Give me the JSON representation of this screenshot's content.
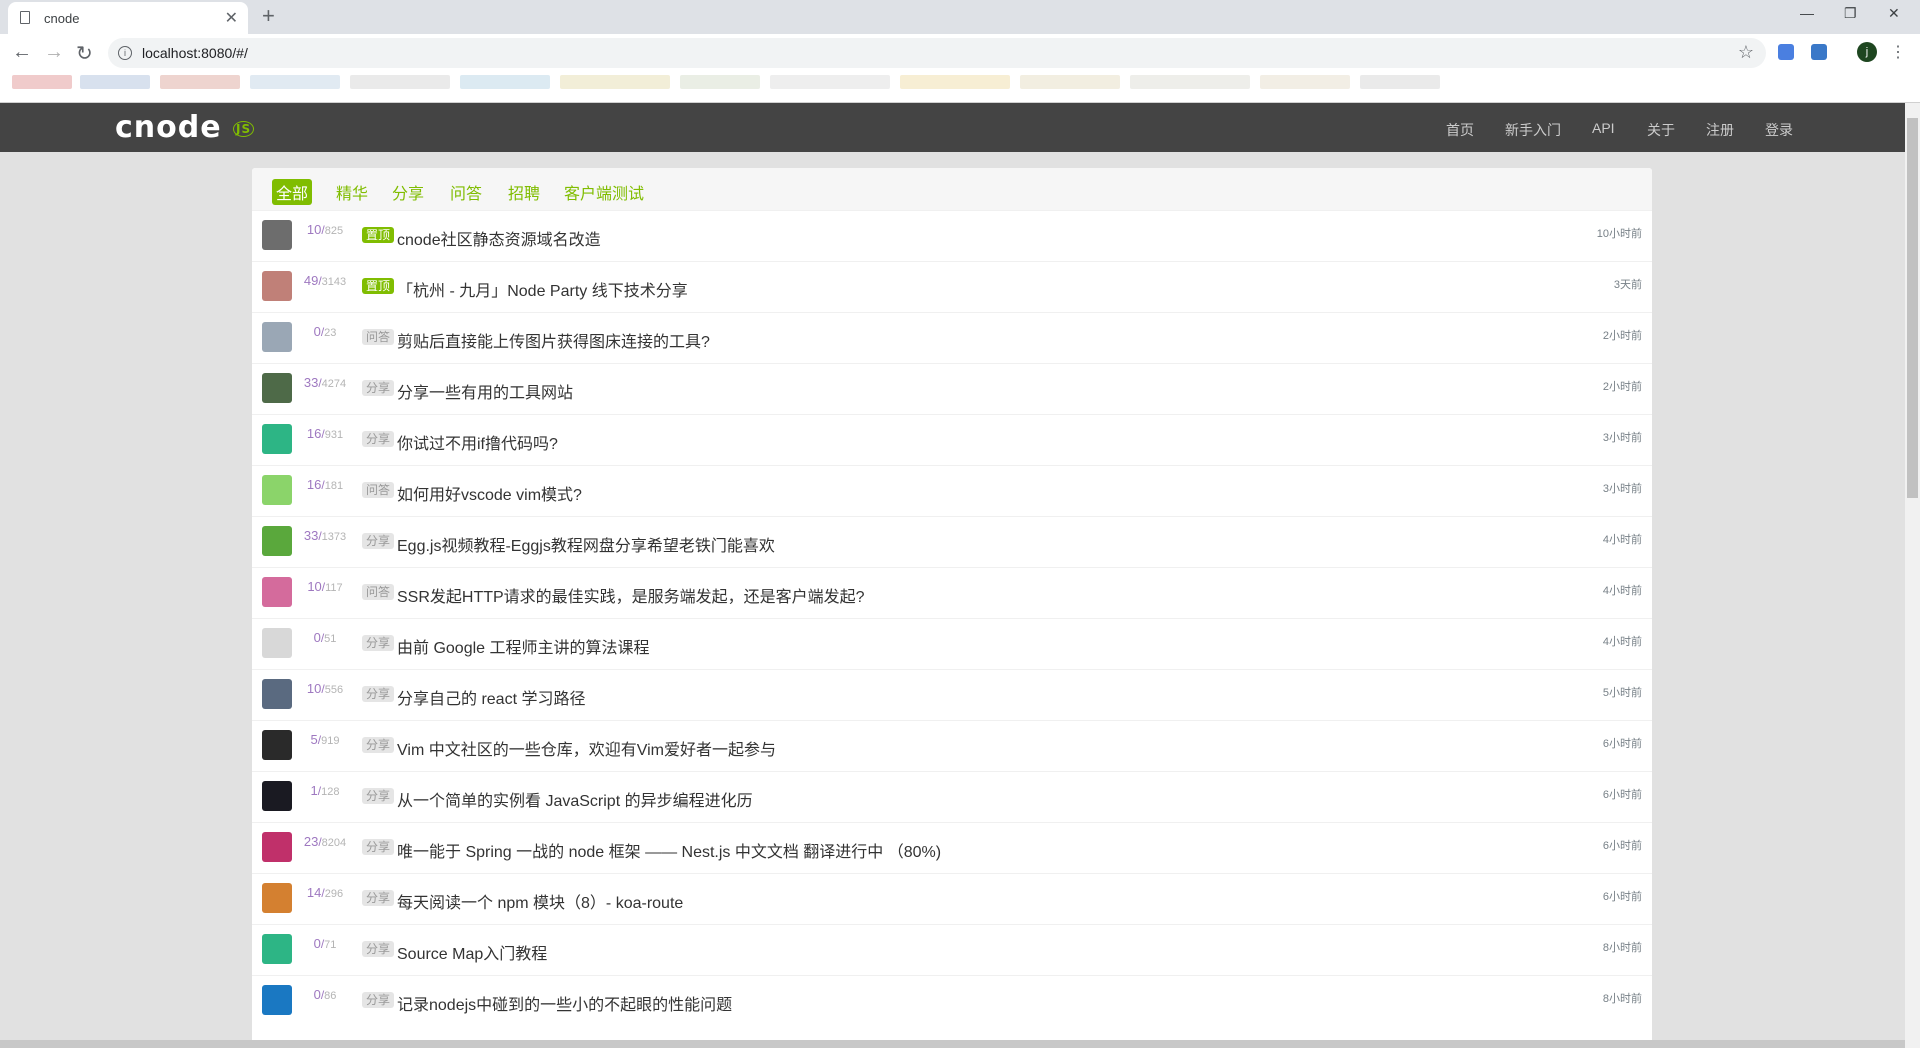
{
  "browser": {
    "tab_title": "cnode",
    "url": "localhost:8080/#/",
    "profile_initial": "j"
  },
  "site": {
    "logo": "cnode",
    "nav": [
      "首页",
      "新手入门",
      "API",
      "关于",
      "注册",
      "登录"
    ]
  },
  "tabs": [
    "全部",
    "精华",
    "分享",
    "问答",
    "招聘",
    "客户端测试"
  ],
  "topics": [
    {
      "reply": "10",
      "visit": "825",
      "tag": "置顶",
      "tag_type": "top",
      "title": "cnode社区静态资源域名改造",
      "time": "10小时前",
      "avatar": "#6d6d6d"
    },
    {
      "reply": "49",
      "visit": "3143",
      "tag": "置顶",
      "tag_type": "top",
      "title": "「杭州 - 九月」Node Party 线下技术分享",
      "time": "3天前",
      "avatar": "#c08078"
    },
    {
      "reply": "0",
      "visit": "23",
      "tag": "问答",
      "tag_type": "normal",
      "title": "剪贴后直接能上传图片获得图床连接的工具?",
      "time": "2小时前",
      "avatar": "#9aa7b5"
    },
    {
      "reply": "33",
      "visit": "4274",
      "tag": "分享",
      "tag_type": "normal",
      "title": "分享一些有用的工具网站",
      "time": "2小时前",
      "avatar": "#4e6a48"
    },
    {
      "reply": "16",
      "visit": "931",
      "tag": "分享",
      "tag_type": "normal",
      "title": "你试过不用if撸代码吗?",
      "time": "3小时前",
      "avatar": "#2db585"
    },
    {
      "reply": "16",
      "visit": "181",
      "tag": "问答",
      "tag_type": "normal",
      "title": "如何用好vscode vim模式?",
      "time": "3小时前",
      "avatar": "#8bd46a"
    },
    {
      "reply": "33",
      "visit": "1373",
      "tag": "分享",
      "tag_type": "normal",
      "title": "Egg.js视频教程-Eggjs教程网盘分享希望老铁门能喜欢",
      "time": "4小时前",
      "avatar": "#5aa83c"
    },
    {
      "reply": "10",
      "visit": "117",
      "tag": "问答",
      "tag_type": "normal",
      "title": "SSR发起HTTP请求的最佳实践，是服务端发起，还是客户端发起?",
      "time": "4小时前",
      "avatar": "#d46b9c"
    },
    {
      "reply": "0",
      "visit": "51",
      "tag": "分享",
      "tag_type": "normal",
      "title": "由前 Google 工程师主讲的算法课程",
      "time": "4小时前",
      "avatar": "#d8d8d8"
    },
    {
      "reply": "10",
      "visit": "556",
      "tag": "分享",
      "tag_type": "normal",
      "title": "分享自己的 react 学习路径",
      "time": "5小时前",
      "avatar": "#5a6a80"
    },
    {
      "reply": "5",
      "visit": "919",
      "tag": "分享",
      "tag_type": "normal",
      "title": "Vim 中文社区的一些仓库，欢迎有Vim爱好者一起参与",
      "time": "6小时前",
      "avatar": "#2a2a2a"
    },
    {
      "reply": "1",
      "visit": "128",
      "tag": "分享",
      "tag_type": "normal",
      "title": "从一个简单的实例看 JavaScript 的异步编程进化历",
      "time": "6小时前",
      "avatar": "#1a1a22"
    },
    {
      "reply": "23",
      "visit": "8204",
      "tag": "分享",
      "tag_type": "normal",
      "title": "唯一能于 Spring 一战的 node 框架 —— Nest.js 中文文档 翻译进行中 （80%)",
      "time": "6小时前",
      "avatar": "#c0306a"
    },
    {
      "reply": "14",
      "visit": "296",
      "tag": "分享",
      "tag_type": "normal",
      "title": "每天阅读一个 npm 模块（8）- koa-route",
      "time": "6小时前",
      "avatar": "#d48030"
    },
    {
      "reply": "0",
      "visit": "71",
      "tag": "分享",
      "tag_type": "normal",
      "title": "Source Map入门教程",
      "time": "8小时前",
      "avatar": "#2db585"
    },
    {
      "reply": "0",
      "visit": "86",
      "tag": "分享",
      "tag_type": "normal",
      "title": "记录nodejs中碰到的一些小的不起眼的性能问题",
      "time": "8小时前",
      "avatar": "#1a78c2"
    }
  ],
  "colors": {
    "brand": "#80bd01",
    "header_bg": "#444444",
    "reply_count": "#9e78c0"
  }
}
